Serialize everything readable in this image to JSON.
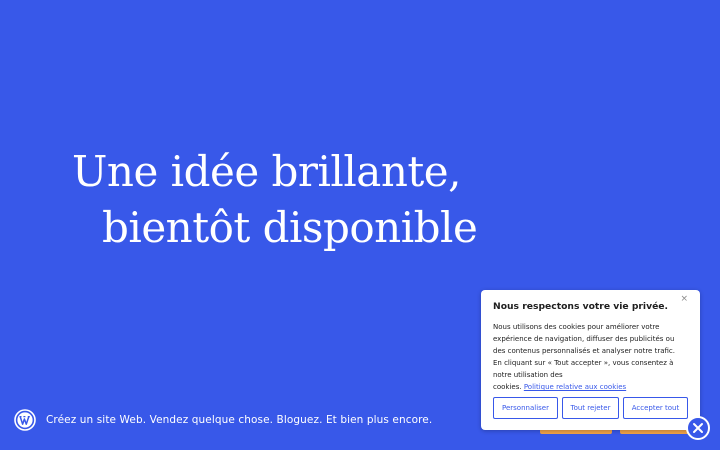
{
  "headline": {
    "line1": "Une idée brillante,",
    "line2": "bientôt disponible"
  },
  "footer": {
    "logo_icon": "wordpress-logo-icon",
    "text": "Créez un site Web. Vendez quelque chose. Bloguez. Et bien plus encore."
  },
  "cookie_banner": {
    "title": "Nous respectons votre vie privée.",
    "close_label": "×",
    "body_lines": [
      "Nous utilisons des cookies pour améliorer votre",
      "expérience de navigation, diffuser des publicités ou",
      "des contenus personnalisés et analyser notre trafic.",
      "En cliquant sur « Tout accepter », vous consentez à",
      "notre utilisation des"
    ],
    "body_last_prefix": "cookies.",
    "policy_link": "Politique relative aux cookies",
    "buttons": {
      "customize": "Personnaliser",
      "reject": "Tout rejeter",
      "accept": "Accepter tout"
    }
  },
  "colors": {
    "background": "#3858e9",
    "text_light": "#ffffff",
    "accent_orange": "#f0a24a"
  }
}
